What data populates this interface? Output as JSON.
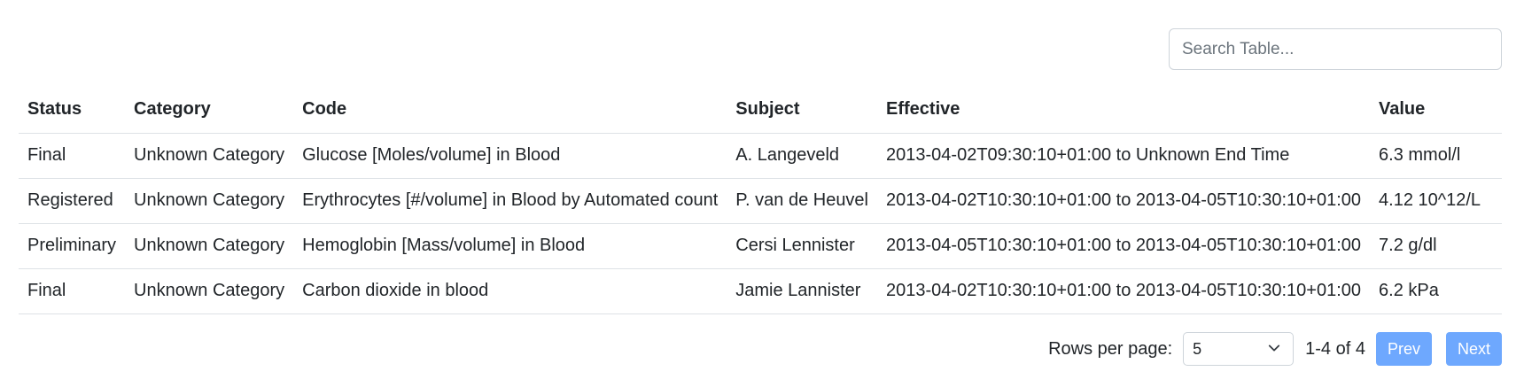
{
  "search": {
    "placeholder": "Search Table..."
  },
  "table": {
    "headers": [
      "Status",
      "Category",
      "Code",
      "Subject",
      "Effective",
      "Value"
    ],
    "rows": [
      [
        "Final",
        "Unknown Category",
        "Glucose [Moles/volume] in Blood",
        "A. Langeveld",
        "2013-04-02T09:30:10+01:00 to Unknown End Time",
        "6.3 mmol/l"
      ],
      [
        "Registered",
        "Unknown Category",
        "Erythrocytes [#/volume] in Blood by Automated count",
        "P. van de Heuvel",
        "2013-04-02T10:30:10+01:00 to 2013-04-05T10:30:10+01:00",
        "4.12 10^12/L"
      ],
      [
        "Preliminary",
        "Unknown Category",
        "Hemoglobin [Mass/volume] in Blood",
        "Cersi Lennister",
        "2013-04-05T10:30:10+01:00 to 2013-04-05T10:30:10+01:00",
        "7.2 g/dl"
      ],
      [
        "Final",
        "Unknown Category",
        "Carbon dioxide in blood",
        "Jamie Lannister",
        "2013-04-02T10:30:10+01:00 to 2013-04-05T10:30:10+01:00",
        "6.2 kPa"
      ]
    ]
  },
  "pagination": {
    "rows_label": "Rows per page:",
    "rows_value": "5",
    "range": "1-4 of 4",
    "prev": "Prev",
    "next": "Next",
    "button_color": "#6ea8fe"
  }
}
